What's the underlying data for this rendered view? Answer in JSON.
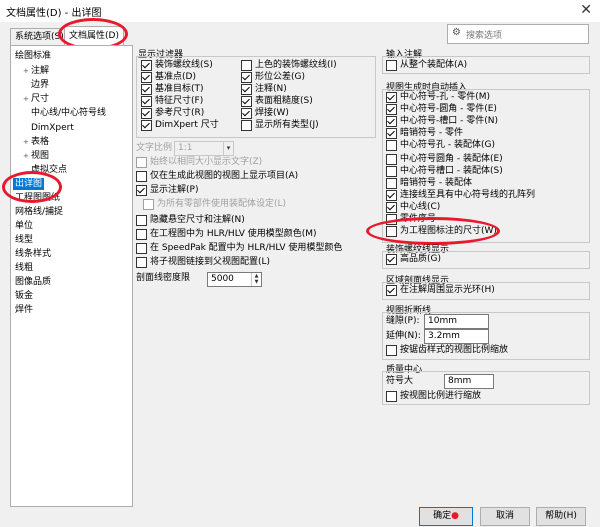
{
  "window": {
    "title": "文档属性(D) - 出详图",
    "close_glyph": "✕"
  },
  "tabs": [
    {
      "label": "系统选项(S)",
      "active": false
    },
    {
      "label": "文档属性(D)",
      "active": true
    }
  ],
  "search": {
    "placeholder": "搜索选项",
    "icon": "gear-icon"
  },
  "tree": {
    "items": [
      {
        "label": "绘图标准",
        "indent": 0,
        "expander": ""
      },
      {
        "label": "注解",
        "indent": 1,
        "expander": "+"
      },
      {
        "label": "边界",
        "indent": 1,
        "expander": ""
      },
      {
        "label": "尺寸",
        "indent": 1,
        "expander": "+"
      },
      {
        "label": "中心线/中心符号线",
        "indent": 1,
        "expander": ""
      },
      {
        "label": "DimXpert",
        "indent": 1,
        "expander": ""
      },
      {
        "label": "表格",
        "indent": 1,
        "expander": "+"
      },
      {
        "label": "视图",
        "indent": 1,
        "expander": "+"
      },
      {
        "label": "虚拟交点",
        "indent": 1,
        "expander": ""
      },
      {
        "label": "出详图",
        "indent": 0,
        "expander": "",
        "selected": true
      },
      {
        "label": "工程图图纸",
        "indent": 0,
        "expander": ""
      },
      {
        "label": "网格线/捕捉",
        "indent": 0,
        "expander": ""
      },
      {
        "label": "单位",
        "indent": 0,
        "expander": ""
      },
      {
        "label": "线型",
        "indent": 0,
        "expander": ""
      },
      {
        "label": "线条样式",
        "indent": 0,
        "expander": ""
      },
      {
        "label": "线粗",
        "indent": 0,
        "expander": ""
      },
      {
        "label": "图像品质",
        "indent": 0,
        "expander": ""
      },
      {
        "label": "钣金",
        "indent": 0,
        "expander": ""
      },
      {
        "label": "焊件",
        "indent": 0,
        "expander": ""
      }
    ]
  },
  "display_filter": {
    "title": "显示过滤器",
    "left": [
      {
        "label": "装饰螺纹线(S)",
        "checked": true
      },
      {
        "label": "基准点(D)",
        "checked": true
      },
      {
        "label": "基准目标(T)",
        "checked": true
      },
      {
        "label": "特征尺寸(F)",
        "checked": true
      },
      {
        "label": "参考尺寸(R)",
        "checked": true
      },
      {
        "label": "DimXpert 尺寸",
        "checked": true
      }
    ],
    "right": [
      {
        "label": "上色的装饰螺纹线(I)",
        "checked": false
      },
      {
        "label": "形位公差(G)",
        "checked": true
      },
      {
        "label": "注释(N)",
        "checked": true
      },
      {
        "label": "表面粗糙度(S)",
        "checked": true
      },
      {
        "label": "焊接(W)",
        "checked": true
      },
      {
        "label": "显示所有类型(J)",
        "checked": false
      }
    ]
  },
  "text_scale": {
    "label": "文字比例",
    "value": "1:1"
  },
  "options": [
    {
      "label": "始终以相同大小显示文字(Z)",
      "checked": false,
      "disabled": true
    },
    {
      "label": "仅在生成此视图的视图上显示项目(A)",
      "checked": false,
      "disabled": false
    },
    {
      "label": "显示注解(P)",
      "checked": true,
      "disabled": false
    },
    {
      "label": "为所有零部件使用装配体设定(L)",
      "checked": false,
      "disabled": true
    },
    {
      "label": "隐藏悬空尺寸和注解(N)",
      "checked": false,
      "disabled": false
    },
    {
      "label": "在工程图中为 HLR/HLV 使用模型颜色(M)",
      "checked": false,
      "disabled": false
    },
    {
      "label": "在 SpeedPak 配置中为 HLR/HLV 使用模型颜色",
      "checked": false,
      "disabled": false
    },
    {
      "label": "将子视图链接到父视图配置(L)",
      "checked": false,
      "disabled": false
    }
  ],
  "section_density": {
    "label": "剖面线密度限",
    "value": "5000"
  },
  "input_annotations": {
    "title": "输入注解",
    "items": [
      {
        "label": "从整个装配体(A)",
        "checked": false
      }
    ]
  },
  "auto_insert": {
    "title": "视图生成时自动插入",
    "items": [
      {
        "label": "中心符号-孔 - 零件(M)",
        "checked": true
      },
      {
        "label": "中心符号-圆角 - 零件(E)",
        "checked": true
      },
      {
        "label": "中心符号-槽口 - 零件(N)",
        "checked": true
      },
      {
        "label": "暗销符号 - 零件",
        "checked": true
      },
      {
        "label": "中心符号孔 - 装配体(G)",
        "checked": false
      },
      {
        "label": "中心符号圆角 - 装配体(E)",
        "checked": false
      },
      {
        "label": "中心符号槽口 - 装配体(S)",
        "checked": false
      },
      {
        "label": "暗销符号 - 装配体",
        "checked": false
      },
      {
        "label": "连接线至具有中心符号线的孔阵列",
        "checked": true
      },
      {
        "label": "中心线(C)",
        "checked": true
      },
      {
        "label": "零件序号",
        "checked": false
      },
      {
        "label": "为工程图标注的尺寸(W)",
        "checked": false
      }
    ]
  },
  "cosmetic_thread": {
    "title": "装饰螺纹线显示",
    "items": [
      {
        "label": "高品质(G)",
        "checked": true
      }
    ]
  },
  "area_hatch": {
    "title": "区域剖面线显示",
    "items": [
      {
        "label": "在注解周围显示光环(H)",
        "checked": true
      }
    ]
  },
  "view_break": {
    "title": "视图折断线",
    "gap_label": "缝隙(P):",
    "gap_value": "10mm",
    "ext_label": "延伸(N):",
    "ext_value": "3.2mm",
    "zigzag_label": "按锯齿样式的视图比例缩放",
    "zigzag_checked": false
  },
  "center_of_mass": {
    "title": "质量中心",
    "size_label": "符号大",
    "size_value": "8mm",
    "scale_label": "按视图比例进行缩放",
    "scale_checked": false
  },
  "buttons": {
    "ok": "确定",
    "cancel": "取消",
    "help": "帮助(H)"
  },
  "colors": {
    "accent": "#0078d7",
    "annotation_red": "#e8192c"
  }
}
